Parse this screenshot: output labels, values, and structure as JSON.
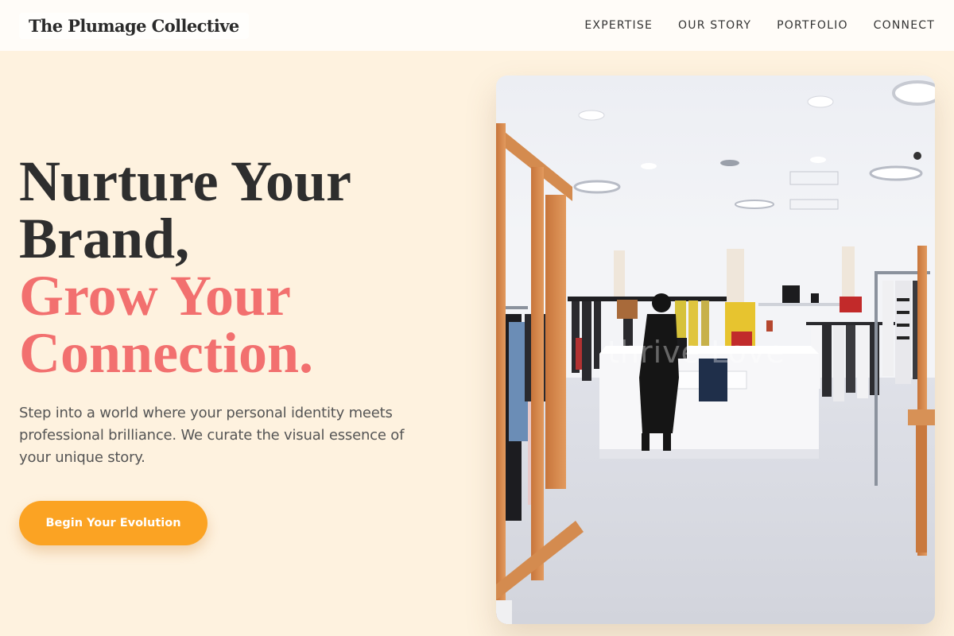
{
  "header": {
    "logo": "The Plumage Collective",
    "nav": [
      {
        "label": "EXPERTISE"
      },
      {
        "label": "OUR STORY"
      },
      {
        "label": "PORTFOLIO"
      },
      {
        "label": "CONNECT"
      }
    ]
  },
  "hero": {
    "headline_line1": "Nurture Your",
    "headline_line2": "Brand,",
    "headline_accent_line1": "Grow Your",
    "headline_accent_line2": "Connection.",
    "subtext": "Step into a world where your personal identity meets professional brilliance. We curate the visual essence of your unique story.",
    "cta_label": "Begin Your Evolution",
    "image_watermark": "thrive Love"
  },
  "colors": {
    "background": "#fef2df",
    "accent": "#f2706f",
    "cta": "#fba323",
    "header": "#fffcf8"
  }
}
